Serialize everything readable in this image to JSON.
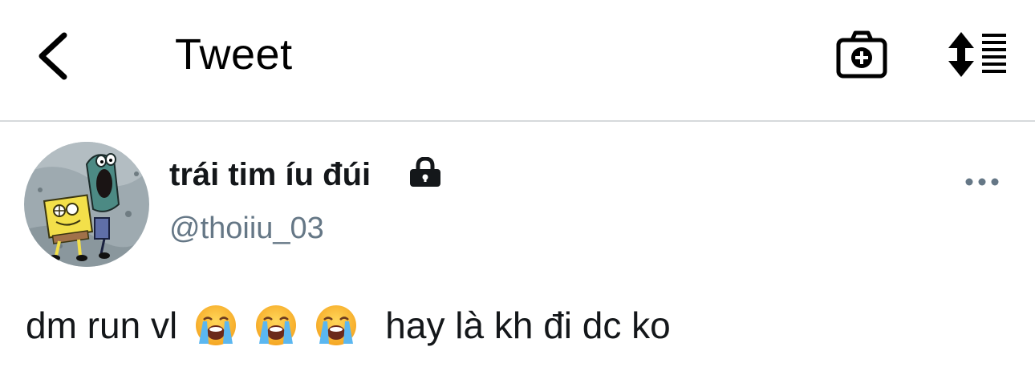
{
  "header": {
    "title": "Tweet",
    "back_icon": "chevron-left-icon",
    "camera_icon": "camera-add-icon",
    "sort_icon": "sort-list-icon"
  },
  "tweet": {
    "author": {
      "display_name": "trái tim íu đúi",
      "handle": "@thoiiu_03",
      "protected_icon": "lock-icon",
      "avatar": "spongebob-avatar"
    },
    "more_icon": "more-dots-icon",
    "text_before": "dm run vl",
    "emojis": [
      "loudly-crying-face-emoji",
      "loudly-crying-face-emoji",
      "loudly-crying-face-emoji"
    ],
    "text_after": "hay là kh đi dc ko"
  },
  "colors": {
    "text_primary": "#14171a",
    "text_secondary": "#657786",
    "divider": "#d6d9dc",
    "background": "#ffffff"
  }
}
